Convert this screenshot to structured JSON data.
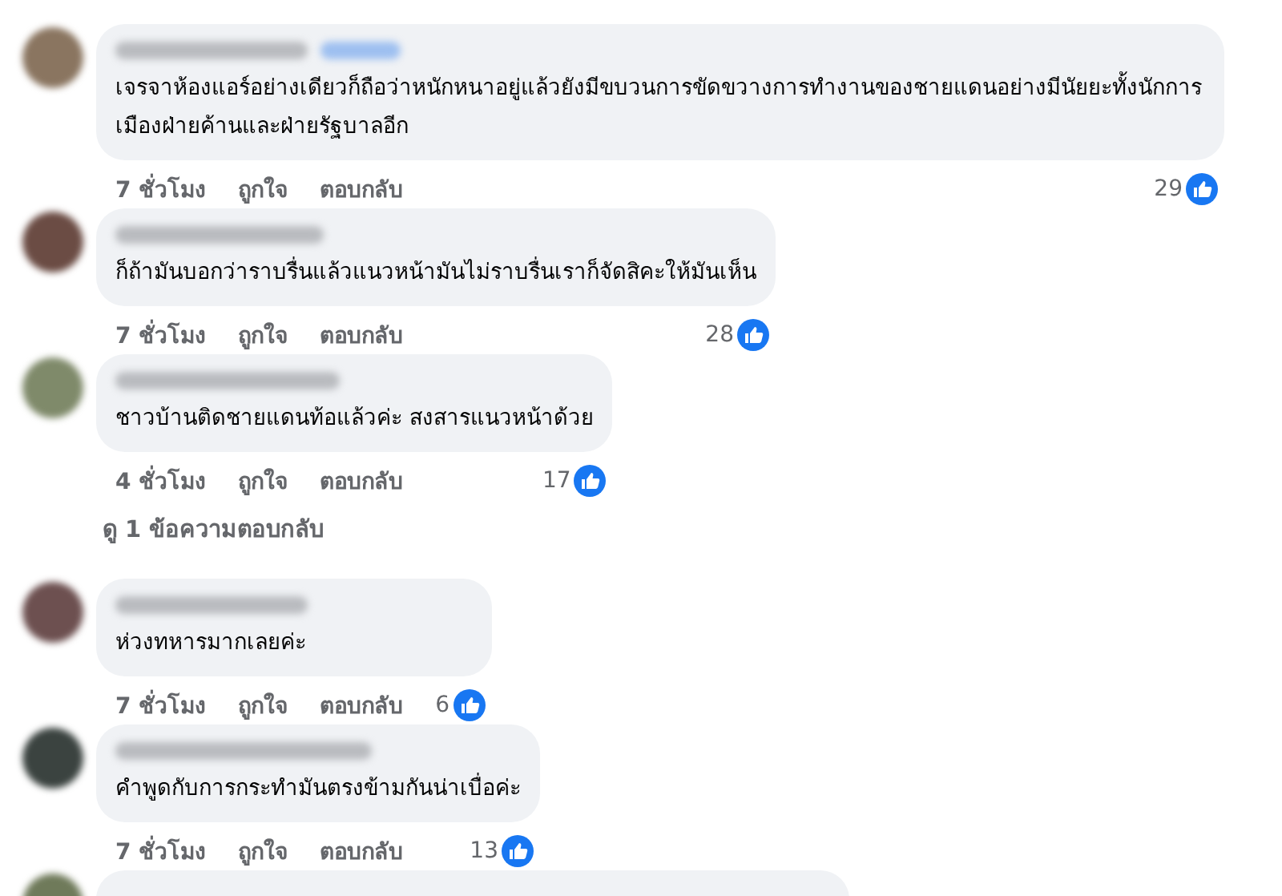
{
  "comments": [
    {
      "author_badge": true,
      "text": "เจรจาห้องแอร์อย่างเดียวก็ถือว่าหนักหนาอยู่แล้วยังมีขบวนการขัดขวางการทำงานของชายแดนอย่างมีนัยยะทั้งนักการเมืองฝ่ายค้านและฝ่ายรัฐบาลอีก",
      "time": "7 ชั่วโมง",
      "like": "ถูกใจ",
      "reply": "ตอบกลับ",
      "likes": "29"
    },
    {
      "author_badge": false,
      "text": "ก็ถ้ามันบอกว่าราบรื่นแล้วแนวหน้ามันไม่ราบรื่นเราก็จัดสิคะให้มันเห็น",
      "time": "7 ชั่วโมง",
      "like": "ถูกใจ",
      "reply": "ตอบกลับ",
      "likes": "28"
    },
    {
      "author_badge": false,
      "text": "ชาวบ้านติดชายแดนท้อแล้วค่ะ สงสารแนวหน้าด้วย",
      "time": "4 ชั่วโมง",
      "like": "ถูกใจ",
      "reply": "ตอบกลับ",
      "likes": "17",
      "replies_link": "ดู 1 ข้อความตอบกลับ"
    },
    {
      "author_badge": false,
      "text": "ห่วงทหารมากเลยค่ะ",
      "time": "7 ชั่วโมง",
      "like": "ถูกใจ",
      "reply": "ตอบกลับ",
      "likes": "6"
    },
    {
      "author_badge": false,
      "text": "คำพูดกับการกระทำมันตรงข้ามกันน่าเบื่อค่ะ",
      "time": "7 ชั่วโมง",
      "like": "ถูกใจ",
      "reply": "ตอบกลับ",
      "likes": "13"
    }
  ]
}
